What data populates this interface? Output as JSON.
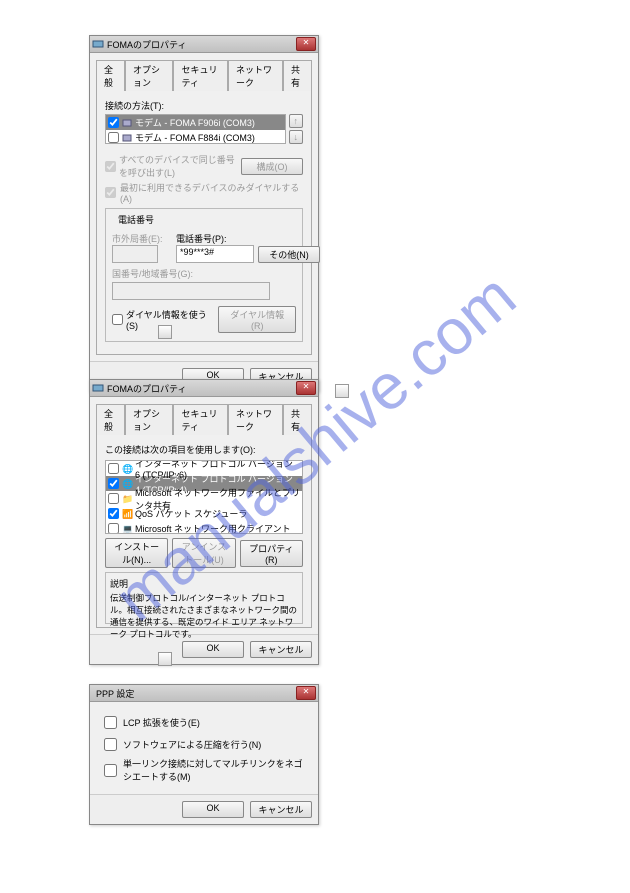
{
  "watermark": "manualshive.com",
  "dialog1": {
    "title": "FOMAのプロパティ",
    "tabs": [
      "全般",
      "オプション",
      "セキュリティ",
      "ネットワーク",
      "共有"
    ],
    "connect_group_label": "接続の方法(T):",
    "modem1": "モデム - FOMA F906i (COM3)",
    "modem2": "モデム - FOMA F884i (COM3)",
    "side_btn1": "↑",
    "side_btn2": "↓",
    "all_devices": "すべてのデバイスで同じ番号を呼び出す(L)",
    "configure_btn": "構成(O)",
    "only_connected": "最初に利用できるデバイスのみダイヤルする(A)",
    "phone_group": "電話番号",
    "area_code_label": "市外局番(E):",
    "phone_label": "電話番号(P):",
    "phone_value": "*99***3#",
    "other_btn": "その他(N)",
    "country_label": "国番号/地域番号(G):",
    "use_rules": "ダイヤル情報を使う(S)",
    "dial_info_btn": "ダイヤル情報(R)",
    "ok": "OK",
    "cancel": "キャンセル"
  },
  "dialog2": {
    "title": "FOMAのプロパティ",
    "tabs": [
      "全般",
      "オプション",
      "セキュリティ",
      "ネットワーク",
      "共有"
    ],
    "uses_label": "この接続は次の項目を使用します(O):",
    "items": [
      {
        "checked": false,
        "label": "インターネット プロトコル バージョン 6 (TCP/IPv6)"
      },
      {
        "checked": true,
        "label": "インターネット プロトコル バージョン 4 (TCP/IPv4)",
        "selected": true
      },
      {
        "checked": false,
        "label": "Microsoft ネットワーク用ファイルとプリンタ共有"
      },
      {
        "checked": true,
        "label": "QoS パケット スケジューラ"
      },
      {
        "checked": false,
        "label": "Microsoft ネットワーク用クライアント"
      }
    ],
    "install_btn": "インストール(N)...",
    "uninstall_btn": "アンインストール(U)",
    "properties_btn": "プロパティ(R)",
    "desc_label": "説明",
    "desc_text": "伝送制御プロトコル/インターネット プロトコル。相互接続されたさまざまなネットワーク間の通信を提供する、既定のワイド エリア ネットワーク プロトコルです。",
    "ok": "OK",
    "cancel": "キャンセル"
  },
  "dialog3": {
    "title": "PPP 設定",
    "opt1": "LCP 拡張を使う(E)",
    "opt2": "ソフトウェアによる圧縮を行う(N)",
    "opt3": "単一リンク接続に対してマルチリンクをネゴシエートする(M)",
    "ok": "OK",
    "cancel": "キャンセル"
  }
}
